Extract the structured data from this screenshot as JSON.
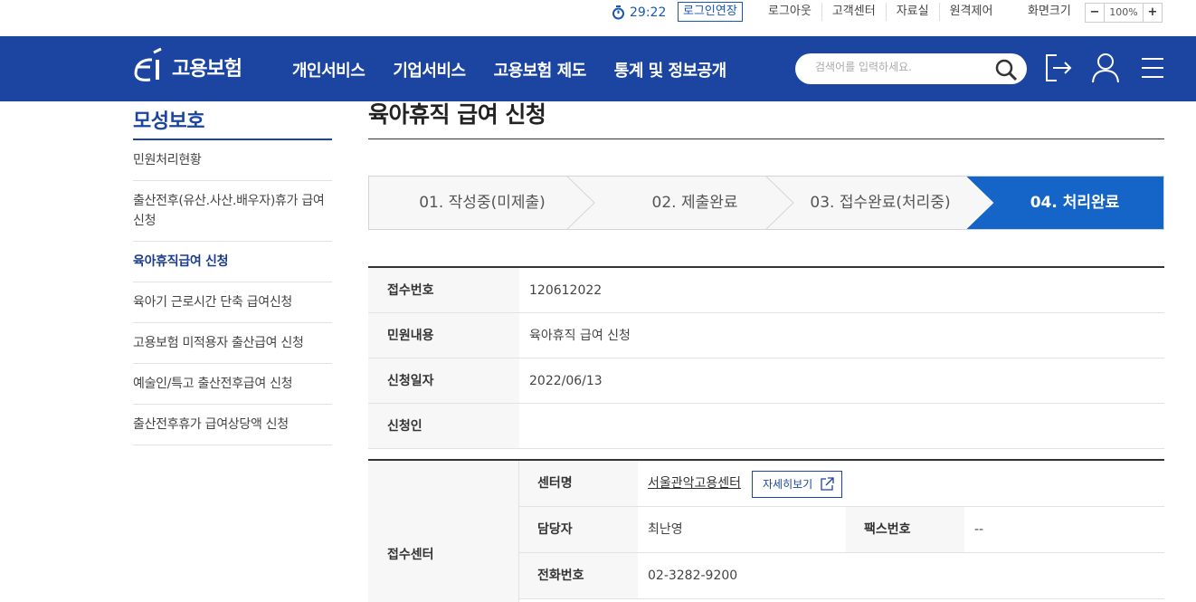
{
  "util": {
    "timer": "29:22",
    "extend_label": "로그인연장",
    "links": [
      "로그아웃",
      "고객센터",
      "자료실",
      "원격제어"
    ],
    "zoom_label": "화면크기",
    "zoom_minus": "−",
    "zoom_value": "100%",
    "zoom_plus": "+"
  },
  "header": {
    "logo_text": "고용보험",
    "nav": [
      "개인서비스",
      "기업서비스",
      "고용보험 제도",
      "통계 및 정보공개"
    ],
    "search_placeholder": "검색어를 입력하세요."
  },
  "sidebar": {
    "title": "모성보호",
    "items": [
      {
        "label": "민원처리현황"
      },
      {
        "label": "출산전후(유산.사산.배우자)휴가 급여신청"
      },
      {
        "label": "육아휴직급여 신청"
      },
      {
        "label": "육아기 근로시간 단축 급여신청"
      },
      {
        "label": "고용보험 미적용자 출산급여 신청"
      },
      {
        "label": "예술인/특고 출산전후급여 신청"
      },
      {
        "label": "출산전후휴가 급여상당액 신청"
      }
    ]
  },
  "main": {
    "title": "육아휴직 급여 신청",
    "steps": [
      "01. 작성중(미제출)",
      "02. 제출완료",
      "03. 접수완료(처리중)",
      "04. 처리완료"
    ],
    "info": [
      {
        "label": "접수번호",
        "value": "120612022"
      },
      {
        "label": "민원내용",
        "value": "육아휴직 급여 신청"
      },
      {
        "label": "신청일자",
        "value": "2022/06/13"
      },
      {
        "label": "신청인",
        "value": ""
      }
    ],
    "center": {
      "label": "접수센터",
      "name_label": "센터명",
      "name": "서울관악고용센터",
      "detail_button": "자세히보기",
      "manager_label": "담당자",
      "manager": "최난영",
      "fax_label": "팩스번호",
      "fax": "--",
      "phone_label": "전화번호",
      "phone": "02-3282-9200"
    }
  },
  "colors": {
    "brand": "#1b45a0",
    "active_step": "#1565c8"
  }
}
